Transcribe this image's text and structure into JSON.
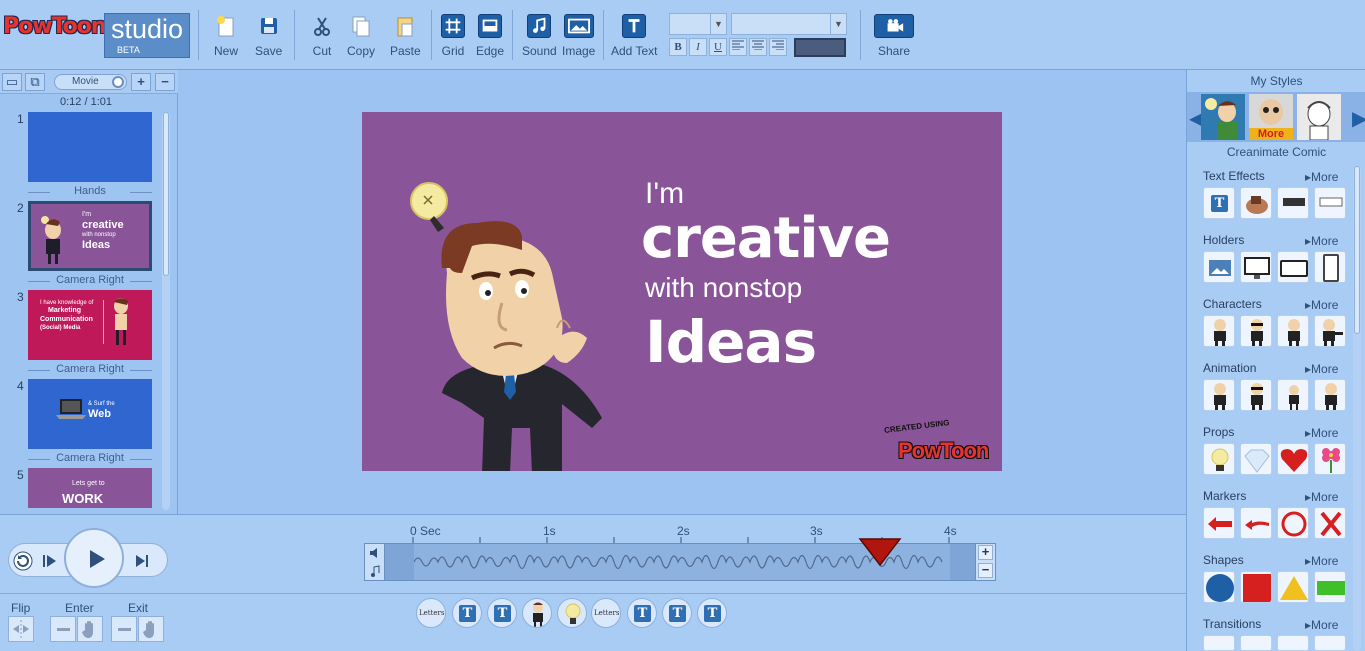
{
  "app": {
    "logo_text": "PowToon",
    "studio_label": "studio",
    "beta_label": "BETA"
  },
  "toolbar": {
    "new": "New",
    "save": "Save",
    "cut": "Cut",
    "copy": "Copy",
    "paste": "Paste",
    "grid": "Grid",
    "edge": "Edge",
    "sound": "Sound",
    "image": "Image",
    "add_text": "Add Text",
    "share": "Share",
    "bold": "B",
    "italic": "I",
    "underline": "U"
  },
  "slides_panel": {
    "mode_label": "Movie",
    "timecode": "0:12 / 1:01",
    "slides": [
      {
        "number": "1",
        "bg": "#2f66d0"
      },
      {
        "number": "2",
        "bg": "#8a5499",
        "line1": "I'm",
        "line2": "creative",
        "line3": "with nonstop",
        "line4": "Ideas"
      },
      {
        "number": "3",
        "bg": "#c0195a",
        "line1": "I have knowledge of",
        "line2": "Marketing",
        "line3": "Communication",
        "line4": "(Social) Media"
      },
      {
        "number": "4",
        "bg": "#2f66d0",
        "line1": "& Surf the",
        "line2": "Web"
      },
      {
        "number": "5",
        "bg": "#8a5499",
        "line1": "Lets get to",
        "line2": "WORK"
      }
    ],
    "transitions": [
      "Hands",
      "Camera Right",
      "Camera Right",
      "Camera Right"
    ]
  },
  "stage": {
    "line1": "I'm",
    "line2": "creative",
    "line3": "with nonstop",
    "line4": "Ideas",
    "created_using": "CREATED USING",
    "brand": "PowToon",
    "bg_color": "#8a5499"
  },
  "right_panel": {
    "title": "My Styles",
    "more_overlay": "More",
    "style_name": "Creanimate Comic",
    "more_label": "More",
    "groups": [
      "Text Effects",
      "Holders",
      "Characters",
      "Animation",
      "Props",
      "Markers",
      "Shapes",
      "Transitions"
    ]
  },
  "timeline": {
    "ticks": [
      "0 Sec",
      "1s",
      "2s",
      "3s",
      "4s"
    ],
    "plus": "+",
    "minus": "−"
  },
  "effects": {
    "flip": "Flip",
    "enter": "Enter",
    "exit": "Exit"
  },
  "layers": {
    "letters_label": "Letters",
    "text_badge": "T"
  }
}
